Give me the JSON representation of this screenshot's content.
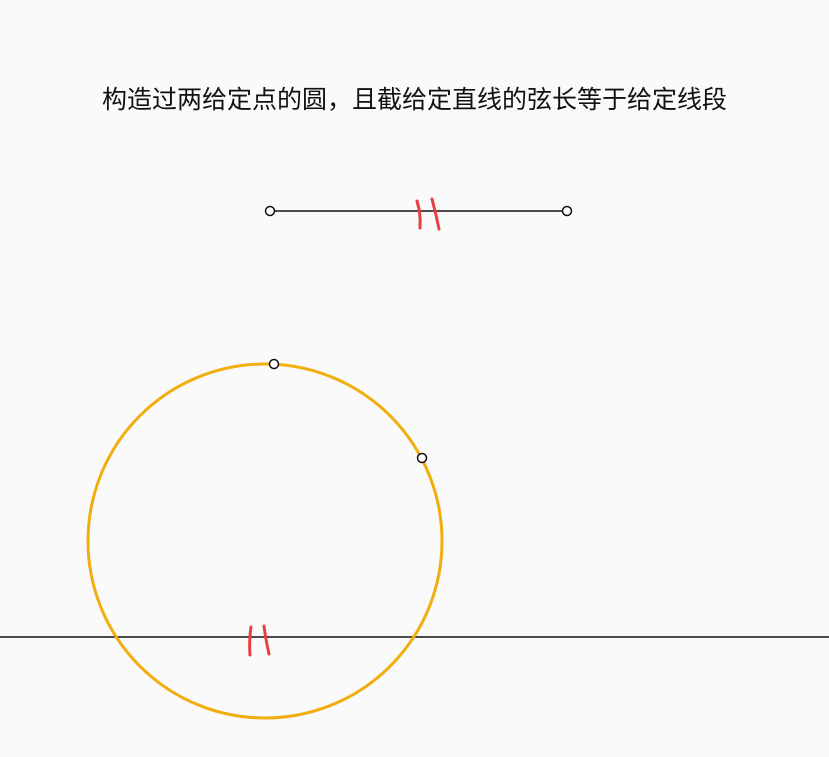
{
  "title": "构造过两给定点的圆，且截给定直线的弦长等于给定线段",
  "colors": {
    "background": "#fafafa",
    "line": "#111111",
    "circle": "#f2ad0f",
    "tick_marks": "#e8403f",
    "point_fill": "#ffffff",
    "point_stroke": "#111111"
  },
  "icons": {
    "tick_mark": "double-tick-equal-length-mark",
    "point": "hollow-point-marker"
  }
}
